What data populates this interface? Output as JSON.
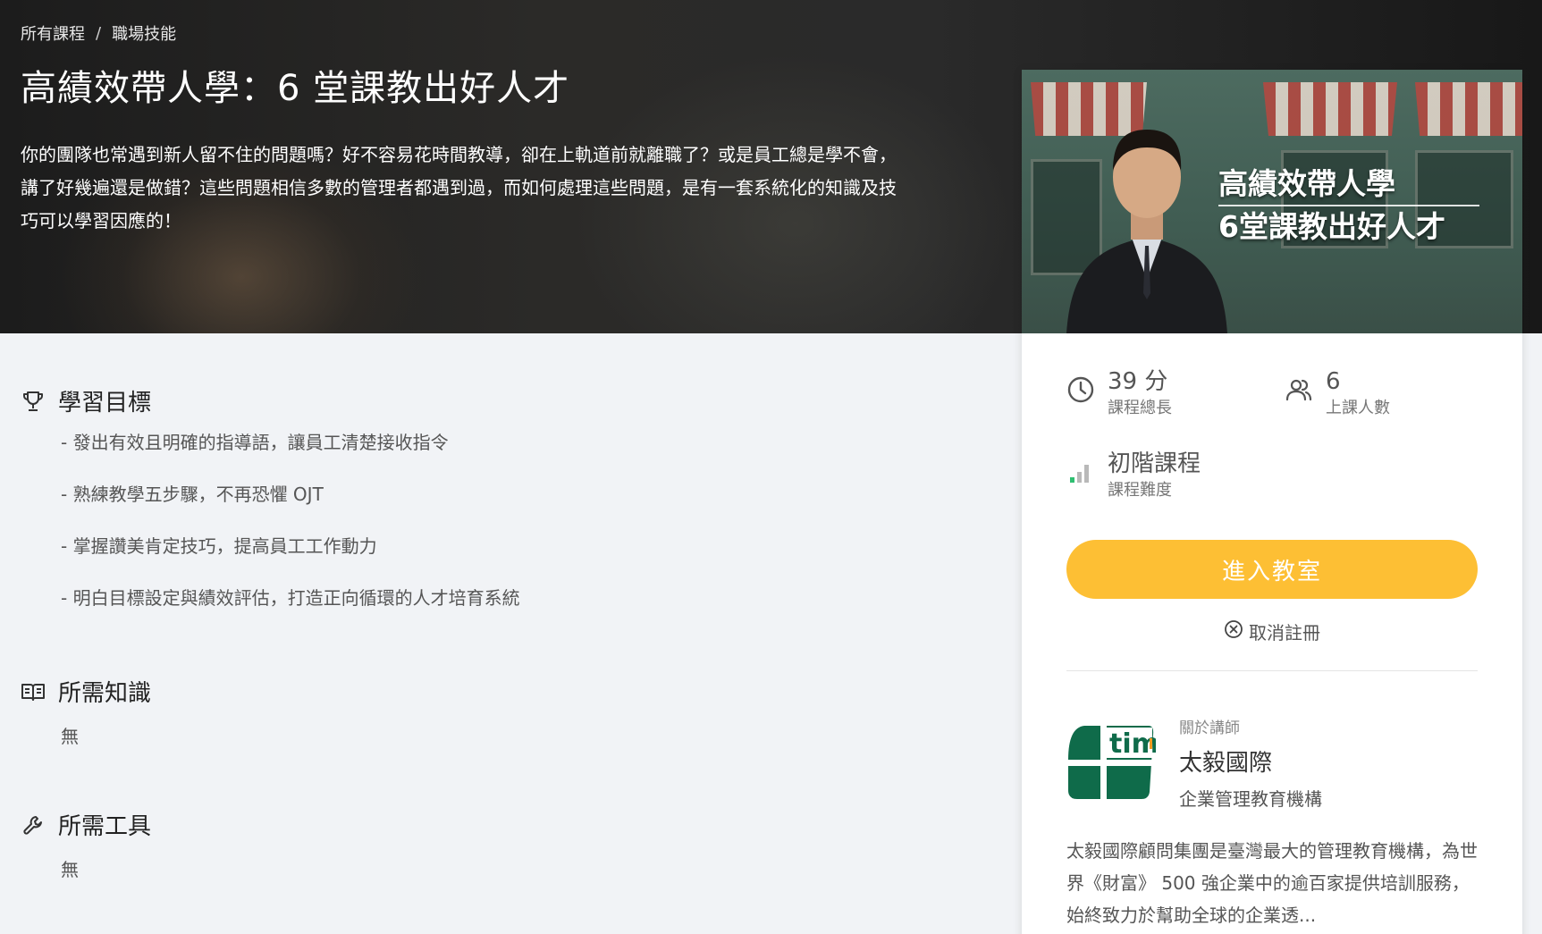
{
  "breadcrumb": {
    "items": [
      "所有課程",
      "職場技能"
    ],
    "separator": "/"
  },
  "course": {
    "title": "高績效帶人學：6 堂課教出好人才",
    "description": "你的團隊也常遇到新人留不住的問題嗎？好不容易花時間教導，卻在上軌道前就離職了？或是員工總是學不會，講了好幾遍還是做錯？這些問題相信多數的管理者都遇到過，而如何處理這些問題，是有一套系統化的知識及技巧可以學習因應的！"
  },
  "sections": {
    "goals": {
      "title": "學習目標",
      "icon": "trophy-icon",
      "items": [
        "- 發出有效且明確的指導語，讓員工清楚接收指令",
        "- 熟練教學五步驟，不再恐懼 OJT",
        "- 掌握讚美肯定技巧，提高員工工作動力",
        "- 明白目標設定與績效評估，打造正向循環的人才培育系統"
      ]
    },
    "knowledge": {
      "title": "所需知識",
      "icon": "book-icon",
      "value": "無"
    },
    "tools": {
      "title": "所需工具",
      "icon": "wrench-icon",
      "value": "無"
    }
  },
  "card": {
    "cover": {
      "title_line1": "高績效帶人學",
      "title_line2": "6堂課教出好人才"
    },
    "stats": {
      "duration": {
        "value": "39 分",
        "label": "課程總長",
        "icon": "clock-icon"
      },
      "students": {
        "value": "6",
        "label": "上課人數",
        "icon": "people-icon"
      },
      "level": {
        "value": "初階課程",
        "label": "課程難度",
        "icon": "difficulty-bars-icon"
      }
    },
    "enter_label": "進入教室",
    "unenroll_label": "取消註冊",
    "instructor": {
      "about_label": "關於講師",
      "name": "太毅國際",
      "org": "企業管理教育機構",
      "description": "太毅國際顧問集團是臺灣最大的管理教育機構，為世界《財富》 500 強企業中的逾百家提供培訓服務，始終致力於幫助全球的企業透...",
      "logo_text": "tim"
    }
  },
  "colors": {
    "accent": "#fdbf34",
    "logo_green": "#0f6b4a",
    "level_green": "#2fbf71"
  }
}
